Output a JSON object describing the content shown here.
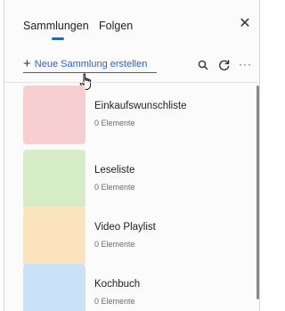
{
  "tabs": [
    {
      "label": "Sammlungen",
      "active": true
    },
    {
      "label": "Folgen",
      "active": false
    }
  ],
  "toolbar": {
    "new_collection_label": "Neue Sammlung erstellen",
    "plus_glyph": "+",
    "icons": [
      "search-icon",
      "refresh-icon",
      "more-icon"
    ],
    "more_glyph": "···",
    "close_glyph": "✕"
  },
  "colors": {
    "accent": "#2a63c6"
  },
  "collections": [
    {
      "title": "Einkaufswunschliste",
      "count": "0 Elemente",
      "color": "#f7cfd1"
    },
    {
      "title": "Leseliste",
      "count": "0 Elemente",
      "color": "#d5ecc6"
    },
    {
      "title": "Video Playlist",
      "count": "0 Elemente",
      "color": "#fbe3be"
    },
    {
      "title": "Kochbuch",
      "count": "0 Elemente",
      "color": "#c9e2f8"
    }
  ]
}
